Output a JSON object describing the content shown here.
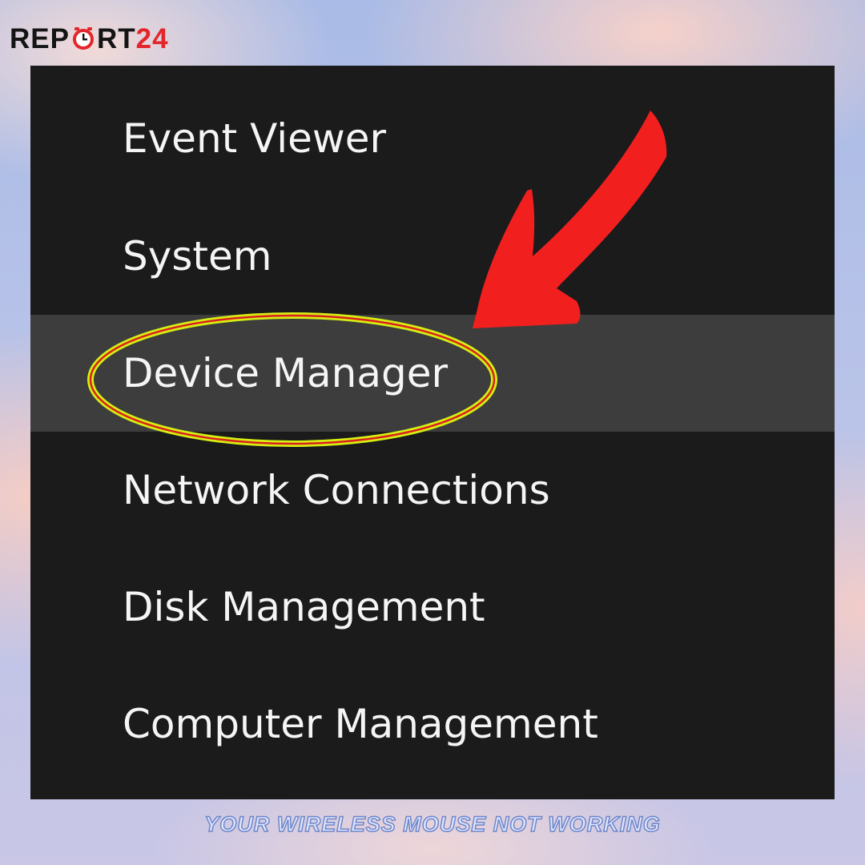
{
  "logo": {
    "part1": "REP",
    "part2": "RT",
    "part3": "24"
  },
  "menu": {
    "items": [
      {
        "label": "Event Viewer",
        "highlighted": false
      },
      {
        "label": "System",
        "highlighted": false
      },
      {
        "label": "Device Manager",
        "highlighted": true
      },
      {
        "label": "Network Connections",
        "highlighted": false
      },
      {
        "label": "Disk Management",
        "highlighted": false
      },
      {
        "label": "Computer Management",
        "highlighted": false
      }
    ]
  },
  "caption": "YOUR WIRELESS MOUSE NOT WORKING",
  "colors": {
    "menu_bg": "#1b1b1b",
    "highlight_bg": "#3d3d3d",
    "arrow": "#f21f1f",
    "ellipse_outer": "#d6ef12",
    "ellipse_inner": "#d92020",
    "logo_red": "#e3262b"
  }
}
